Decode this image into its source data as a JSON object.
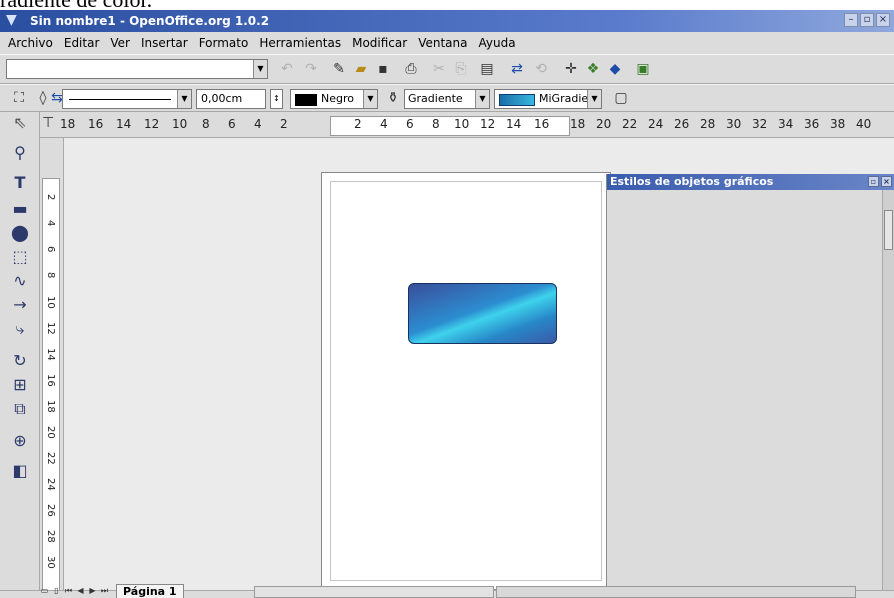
{
  "caption": "radiente de color.",
  "window": {
    "title": "Sin nombre1 - OpenOffice.org 1.0.2",
    "menu_icon": "menu-arrow-icon",
    "buttons": [
      "minimize",
      "maximize",
      "close"
    ]
  },
  "menu": {
    "items": [
      {
        "label": "Archivo"
      },
      {
        "label": "Editar"
      },
      {
        "label": "Ver"
      },
      {
        "label": "Insertar"
      },
      {
        "label": "Formato"
      },
      {
        "label": "Herramientas"
      },
      {
        "label": "Modificar"
      },
      {
        "label": "Ventana"
      },
      {
        "label": "Ayuda"
      }
    ]
  },
  "toolbar1": {
    "url_value": "",
    "icons": [
      "edit-file-icon",
      "open-folder-icon",
      "save-icon",
      "print-icon",
      "spellcheck-icon",
      "navigator-icon",
      "swap-icon",
      "crosshair-icon",
      "gallery-icon",
      "data-sources-icon",
      "image-icon"
    ]
  },
  "toolbar2": {
    "line_width": "0,00cm",
    "line_color": "Negro",
    "area_fill": "Gradiente",
    "gradient_name": "MiGradien",
    "line_color_hex": "#000000",
    "gradient_colors": [
      "#1a6fa8",
      "#38b7e0"
    ]
  },
  "ruler": {
    "h_labels": [
      "18",
      "16",
      "14",
      "12",
      "10",
      "8",
      "6",
      "4",
      "2",
      "2",
      "4",
      "6",
      "8",
      "10",
      "12",
      "14",
      "16",
      "18",
      "20",
      "22",
      "24",
      "26",
      "28",
      "30",
      "32",
      "34",
      "36",
      "38",
      "40"
    ],
    "v_labels": [
      "2",
      "4",
      "6",
      "8",
      "10",
      "12",
      "14",
      "16",
      "18",
      "20",
      "22",
      "24",
      "26",
      "28",
      "30"
    ]
  },
  "stylist": {
    "title": "Estilos de objetos gráficos"
  },
  "footer": {
    "page_tab": "Página 1"
  },
  "shape_colors": [
    "#3a4e9a",
    "#2c8dd0",
    "#3ed2ec"
  ]
}
